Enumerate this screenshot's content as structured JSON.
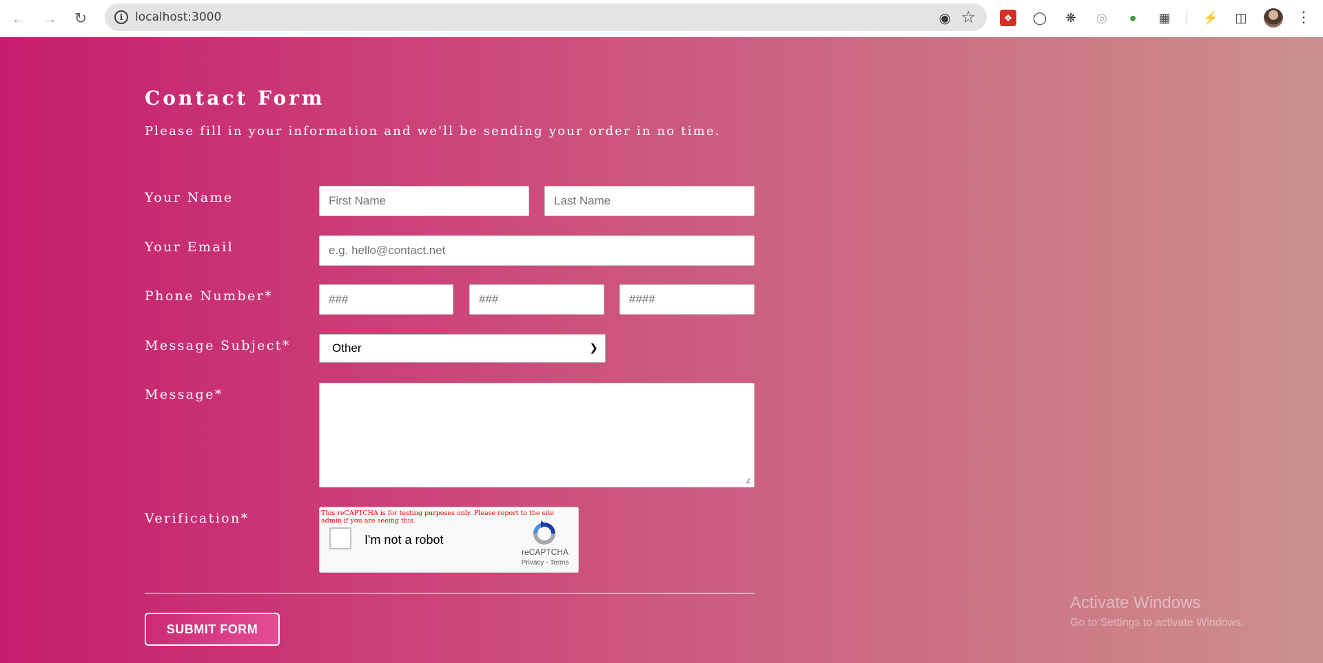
{
  "browser": {
    "url": "localhost:3000"
  },
  "form": {
    "title": "Contact Form",
    "subtitle": "Please fill in your information and we'll be sending your order in no time.",
    "labels": {
      "name": "Your Name",
      "email": "Your Email",
      "phone": "Phone Number*",
      "subject": "Message Subject*",
      "message": "Message*",
      "verification": "Verification*"
    },
    "placeholders": {
      "first_name": "First Name",
      "last_name": "Last Name",
      "email": "e.g. hello@contact.net",
      "phone_area": "###",
      "phone_prefix": "###",
      "phone_line": "####"
    },
    "subject_selected": "Other",
    "submit_label": "SUBMIT FORM"
  },
  "recaptcha": {
    "warning": "This reCAPTCHA is for testing purposes only. Please report to the site admin if you are seeing this.",
    "checkbox_label": "I'm not a robot",
    "brand": "reCAPTCHA",
    "links": "Privacy - Terms"
  },
  "watermark": {
    "title": "Activate Windows",
    "subtitle": "Go to Settings to activate Windows."
  },
  "colors": {
    "gradient_start": "#c51d6e",
    "gradient_end": "#cc9090",
    "captcha_warning": "#ee0000"
  },
  "icons": {
    "back": "arrow-left-icon",
    "forward": "arrow-right-icon",
    "reload": "reload-icon",
    "site_info": "info-icon",
    "eye_off": "eye-off-icon",
    "bookmark": "star-icon"
  }
}
